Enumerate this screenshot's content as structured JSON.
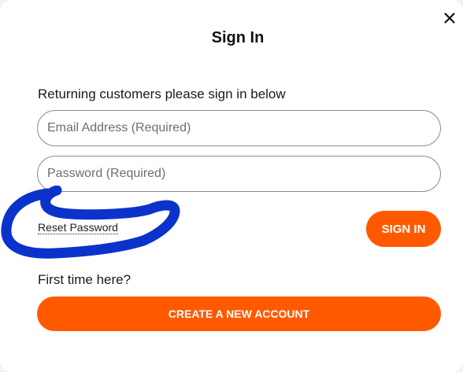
{
  "dialog": {
    "title": "Sign In",
    "close_icon": "close-icon",
    "intro_text": "Returning customers please sign in below",
    "email_placeholder": "Email Address (Required)",
    "email_value": "",
    "password_placeholder": "Password (Required)",
    "password_value": "",
    "reset_password_label": "Reset Password",
    "sign_in_label": "SIGN IN",
    "first_time_text": "First time here?",
    "create_account_label": "CREATE A NEW ACCOUNT"
  },
  "colors": {
    "accent": "#ff5a00",
    "annotation": "#0b33cc"
  }
}
